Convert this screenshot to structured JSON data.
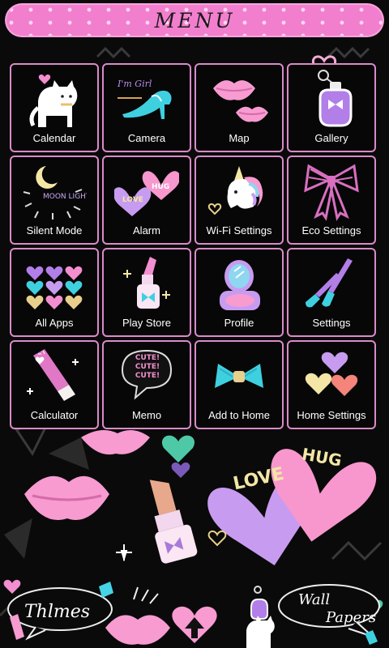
{
  "header": {
    "title": "MENU"
  },
  "tiles": [
    {
      "label": "Calendar",
      "icon": "cat-icon"
    },
    {
      "label": "Camera",
      "icon": "high-heel-icon",
      "icon_text": "I'm Girl"
    },
    {
      "label": "Map",
      "icon": "lips-icon"
    },
    {
      "label": "Gallery",
      "icon": "perfume-icon"
    },
    {
      "label": "Silent Mode",
      "icon": "moon-light-icon",
      "icon_text": "MOON LIGHT"
    },
    {
      "label": "Alarm",
      "icon": "candy-hearts-icon",
      "icon_text_1": "LOVE",
      "icon_text_2": "HUG"
    },
    {
      "label": "Wi-Fi Settings",
      "icon": "unicorn-icon"
    },
    {
      "label": "Eco Settings",
      "icon": "ribbon-bow-icon"
    },
    {
      "label": "All Apps",
      "icon": "hearts-grid-icon"
    },
    {
      "label": "Play Store",
      "icon": "nail-polish-icon"
    },
    {
      "label": "Profile",
      "icon": "compact-mirror-icon"
    },
    {
      "label": "Settings",
      "icon": "makeup-brushes-icon"
    },
    {
      "label": "Calculator",
      "icon": "lipgloss-tube-icon"
    },
    {
      "label": "Memo",
      "icon": "speech-bubble-icon",
      "icon_text": "CUTE! CUTE! CUTE!"
    },
    {
      "label": "Add to Home",
      "icon": "bow-icon"
    },
    {
      "label": "Home Settings",
      "icon": "colorful-hearts-icon"
    }
  ],
  "wallpaper": {
    "heart_1": "LOVE",
    "heart_2": "HUG"
  },
  "bottom": {
    "themes_label": "Thlmes",
    "wallpapers_label_1": "Wall",
    "wallpapers_label_2": "Papers"
  },
  "colors": {
    "accent_pink": "#f27fce",
    "tile_border": "#d98bc8",
    "background": "#0a0a0a"
  }
}
